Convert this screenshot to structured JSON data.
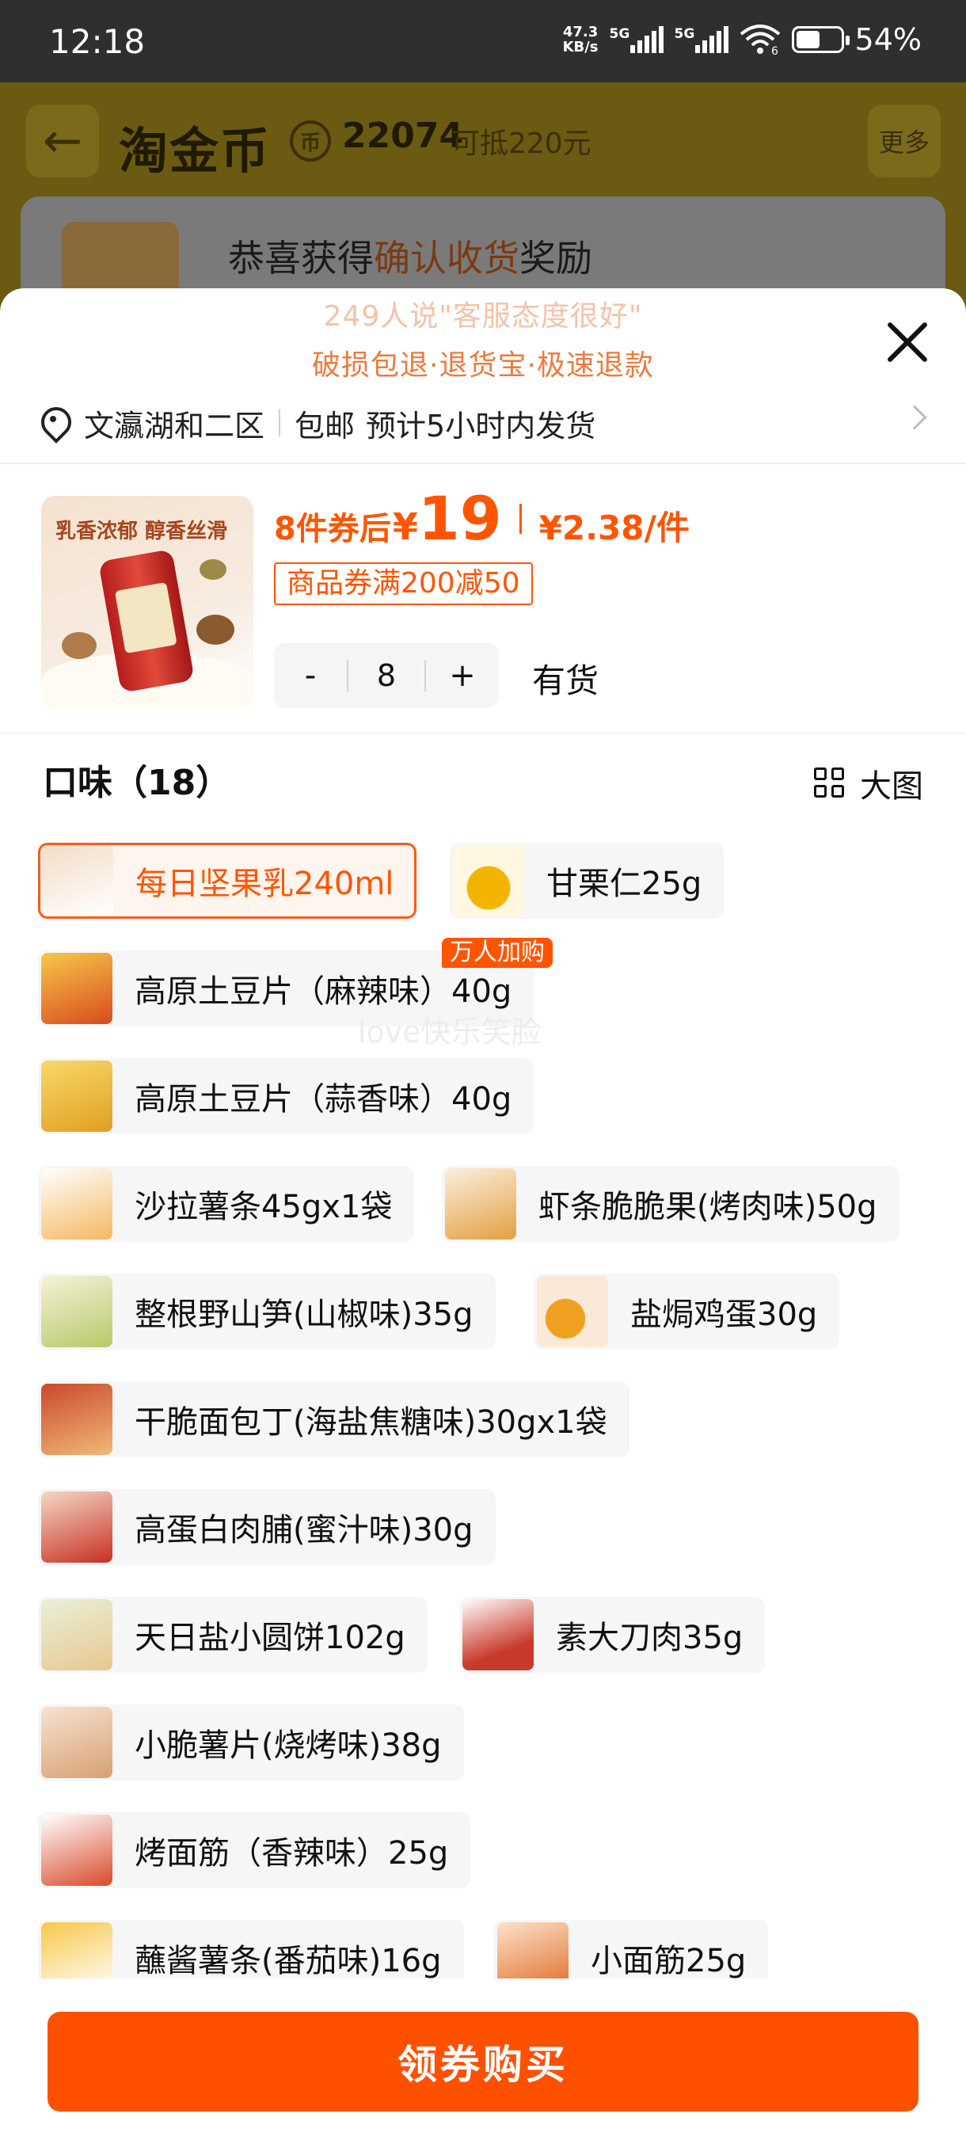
{
  "status_bar": {
    "time": "12:18",
    "net_speed_value": "47.3",
    "net_speed_unit": "KB/s",
    "signal1": "5G",
    "signal2": "5G",
    "wifi_badge": "6",
    "battery": "54%",
    "battery_level": 0.54
  },
  "background_page": {
    "title": "淘金币",
    "coin_icon": "币",
    "coins": "22074",
    "deductible": "可抵220元",
    "more": "更多",
    "banner_prefix": "恭喜获得",
    "banner_highlight": "确认收货",
    "banner_suffix": "奖励"
  },
  "sheet": {
    "promo_line1": "249人说\"客服态度很好\"",
    "promo_line2": "破损包退·退货宝·极速退款",
    "address": "文瀛湖和二区",
    "shipping_free": "包邮",
    "shipping_eta": "预计5小时内发货"
  },
  "product": {
    "image_caption": "乳香浓郁 醇香丝滑",
    "price_prefix": "8件券后",
    "currency": "¥",
    "price": "19",
    "unit_price": "¥2.38/件",
    "coupon": "商品券满200减50",
    "minus": "-",
    "quantity": "8",
    "plus": "+",
    "stock": "有货"
  },
  "flavors": {
    "title": "口味（18）",
    "big_view": "大图",
    "hot_badge": "万人加购",
    "watermark": "love快乐笑脸",
    "items": [
      {
        "label": "每日坚果乳240ml",
        "selected": true
      },
      {
        "label": "甘栗仁25g"
      },
      {
        "label": "高原土豆片（麻辣味）40g"
      },
      {
        "label": "高原土豆片（蒜香味）40g"
      },
      {
        "label": "沙拉薯条45gx1袋"
      },
      {
        "label": "虾条脆脆果(烤肉味)50g"
      },
      {
        "label": "整根野山笋(山椒味)35g"
      },
      {
        "label": "盐焗鸡蛋30g"
      },
      {
        "label": "干脆面包丁(海盐焦糖味)30gx1袋"
      },
      {
        "label": "高蛋白肉脯(蜜汁味)30g"
      },
      {
        "label": "天日盐小圆饼102g"
      },
      {
        "label": "素大刀肉35g"
      },
      {
        "label": "小脆薯片(烧烤味)38g"
      },
      {
        "label": "烤面筋（香辣味）25g"
      },
      {
        "label": "蘸酱薯条(番茄味)16g"
      },
      {
        "label": "小面筋25g"
      }
    ]
  },
  "cta": {
    "label": "领券购买"
  },
  "colors": {
    "accent": "#ff5500",
    "button": "#ff5000"
  }
}
